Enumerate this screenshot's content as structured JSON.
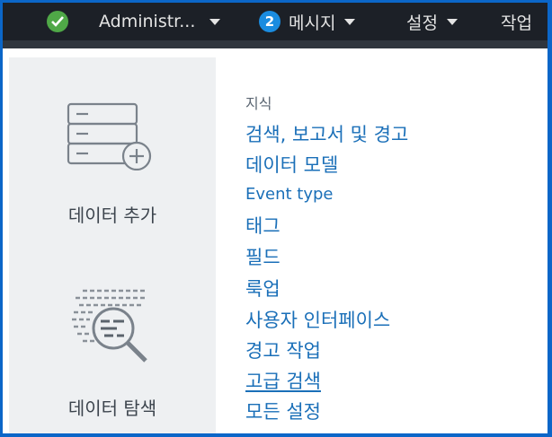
{
  "topbar": {
    "user_label": "Administr...",
    "messages_count": "2",
    "messages_label": "메시지",
    "settings_label": "설정",
    "activity_label": "작업"
  },
  "menu": {
    "tiles": [
      {
        "label": "데이터 추가",
        "icon": "add-data-icon"
      },
      {
        "label": "데이터 탐색",
        "icon": "explore-data-icon"
      }
    ],
    "knowledge_heading": "지식",
    "links": [
      "검색, 보고서 및 경고",
      "데이터 모델",
      "Event type",
      "태그",
      "필드",
      "룩업",
      "사용자 인터페이스",
      "경고 작업",
      "고급 검색",
      "모든 설정"
    ]
  },
  "colors": {
    "topbar": "#1c2027",
    "link": "#1a6fb8",
    "status_ok": "#4fa847",
    "badge": "#1a8ce0",
    "frame_border": "#0b66c8"
  }
}
